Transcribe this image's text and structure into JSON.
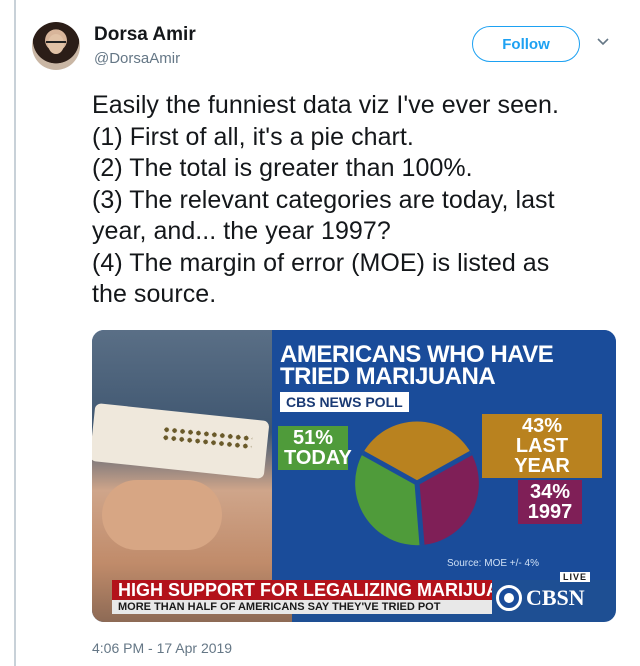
{
  "user": {
    "display_name": "Dorsa Amir",
    "handle": "@DorsaAmir",
    "follow_label": "Follow",
    "avatar_icon": "avatar-photo",
    "menu_icon": "chevron-down-icon"
  },
  "tweet": {
    "lines": [
      "Easily the funniest data viz I've ever seen.",
      "(1) First of all, it's a pie chart.",
      "(2) The total is greater than 100%.",
      "(3) The relevant categories are today, last",
      "year, and... the year 1997?",
      "(4) The margin of error (MOE) is listed as",
      "the source."
    ],
    "timestamp": "4:06 PM - 17 Apr 2019"
  },
  "media": {
    "headline_line1": "AMERICANS WHO HAVE",
    "headline_line2": "TRIED MARIJUANA",
    "poll_tag": "CBS NEWS POLL",
    "labels": {
      "today_pct": "51%",
      "today_name": "TODAY",
      "last_pct": "43%",
      "last_name": "LAST YEAR",
      "y1997_pct": "34%",
      "y1997_name": "1997"
    },
    "source": "Source: MOE +/- 4%",
    "live": "LIVE",
    "ticker_main": "HIGH SUPPORT FOR LEGALIZING MARIJUANA",
    "ticker_sub": "MORE THAN HALF OF AMERICANS SAY THEY'VE TRIED POT",
    "network": "CBSN",
    "colors": {
      "today": "#4f9b3a",
      "last_year": "#b9821f",
      "y1997": "#7f1f57",
      "panel": "#1a4c9a"
    }
  }
}
